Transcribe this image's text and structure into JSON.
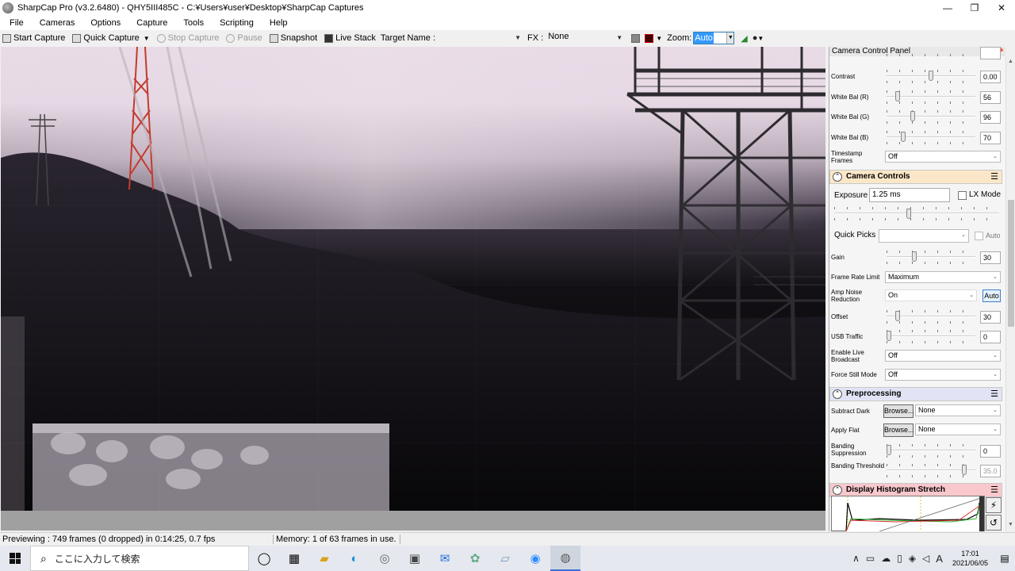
{
  "window": {
    "title": "SharpCap Pro (v3.2.6480) - QHY5III485C - C:¥Users¥user¥Desktop¥SharpCap Captures",
    "controls": [
      "—",
      "❐",
      "✕"
    ]
  },
  "menu": [
    "File",
    "Cameras",
    "Options",
    "Capture",
    "Tools",
    "Scripting",
    "Help"
  ],
  "toolbar": {
    "start_capture": "Start Capture",
    "quick_capture": "Quick Capture",
    "stop_capture": "Stop Capture",
    "pause": "Pause",
    "snapshot": "Snapshot",
    "live_stack": "Live Stack",
    "target_name_label": "Target Name :",
    "target_name_value": "",
    "fx_label": "FX :",
    "fx_value": "None",
    "zoom_label": "Zoom:",
    "zoom_value": "Auto"
  },
  "status": {
    "previewing": "Previewing : 749 frames (0 dropped) in 0:14:25, 0.7 fps",
    "memory": "Memory: 1 of 63 frames in use."
  },
  "panel": {
    "title": "Camera Control Panel",
    "image_controls": [
      {
        "label": "Contrast",
        "value": "0.00",
        "level": 0.5
      },
      {
        "label": "White Bal (R)",
        "value": "56",
        "level": 0.1
      },
      {
        "label": "White Bal (G)",
        "value": "96",
        "level": 0.28
      },
      {
        "label": "White Bal (B)",
        "value": "70",
        "level": 0.17
      }
    ],
    "timestamp_frames": {
      "label": "Timestamp Frames",
      "value": "Off"
    },
    "camera_controls": {
      "header": "Camera Controls",
      "exposure_label": "Exposure",
      "exposure_value": "1.25 ms",
      "lx_mode": "LX Mode",
      "quick_picks": "Quick Picks",
      "auto": "Auto",
      "gain": {
        "label": "Gain",
        "value": "30",
        "level": 0.3
      },
      "frame_rate_limit": {
        "label": "Frame Rate Limit",
        "value": "Maximum"
      },
      "amp_noise": {
        "label": "Amp Noise Reduction",
        "value": "On",
        "auto": "Auto"
      },
      "offset": {
        "label": "Offset",
        "value": "30",
        "level": 0.1
      },
      "usb_traffic": {
        "label": "USB Traffic",
        "value": "0",
        "level": 0.0
      },
      "live_broadcast": {
        "label": "Enable Live Broadcast",
        "value": "Off"
      },
      "force_still": {
        "label": "Force Still Mode",
        "value": "Off"
      }
    },
    "preprocessing": {
      "header": "Preprocessing",
      "subtract_dark": {
        "label": "Subtract Dark",
        "browse": "Browse...",
        "value": "None"
      },
      "apply_flat": {
        "label": "Apply Flat",
        "browse": "Browse...",
        "value": "None"
      },
      "banding_suppression": {
        "label": "Banding Suppression",
        "value": "0",
        "level": 0.0
      },
      "banding_threshold": {
        "label": "Banding Threshold",
        "value": "35.0",
        "level": 0.9
      }
    },
    "histogram": {
      "header": "Display Histogram Stretch"
    }
  },
  "taskbar": {
    "search_placeholder": "ここに入力して検索",
    "time": "17:01",
    "date": "2021/06/05",
    "ime": "A"
  }
}
